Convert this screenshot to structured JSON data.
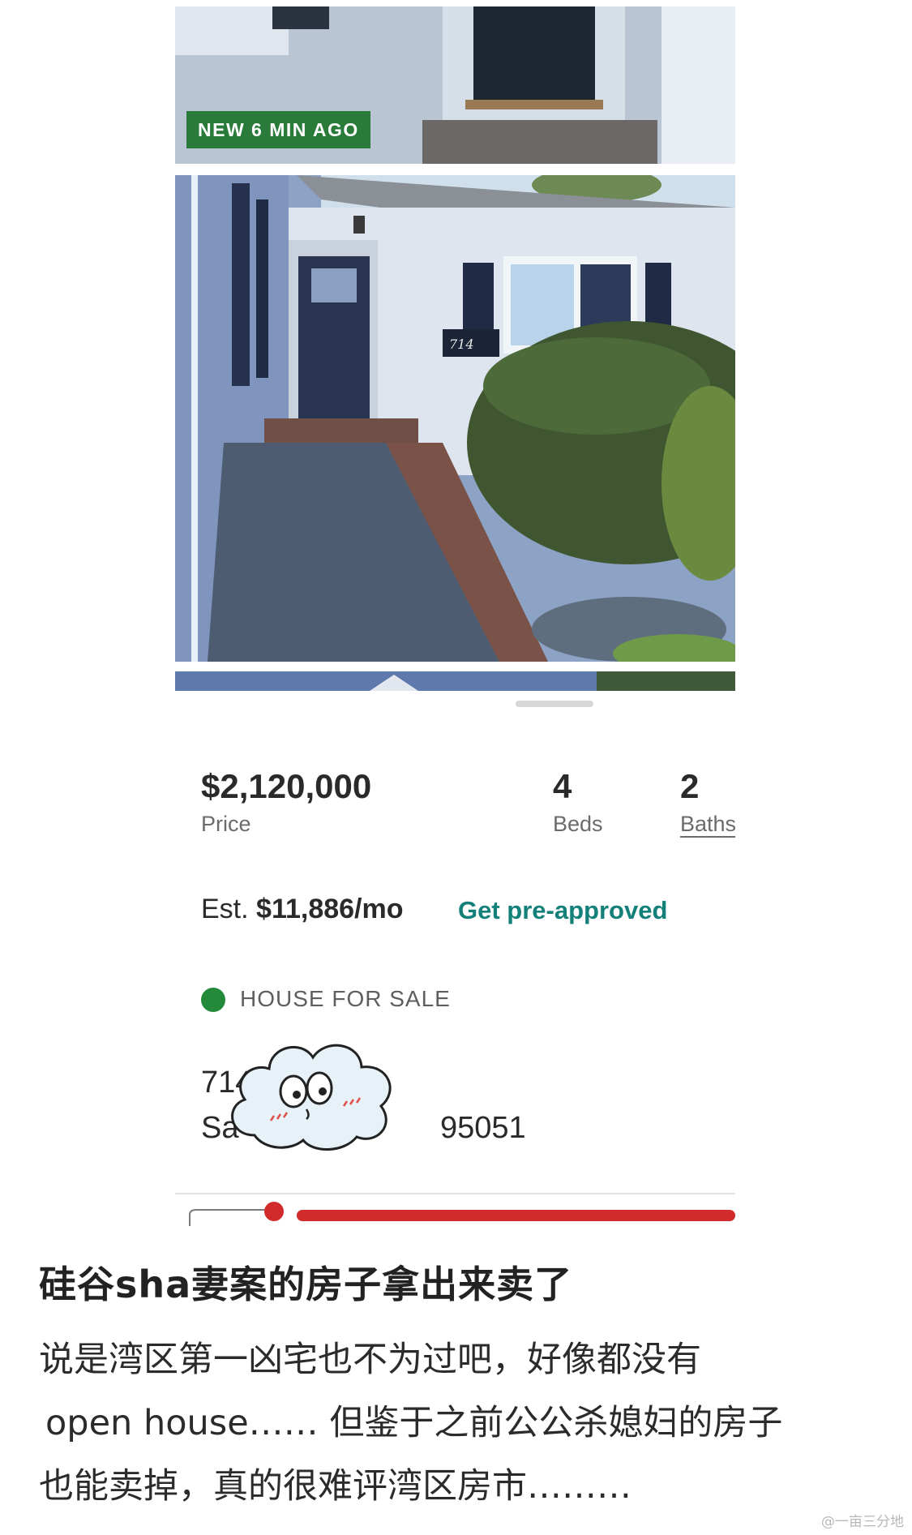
{
  "listing": {
    "badge": "NEW 6 MIN AGO",
    "price": "$2,120,000",
    "price_label": "Price",
    "beds": "4",
    "beds_label": "Beds",
    "baths": "2",
    "baths_label": "Baths",
    "est_prefix": "Est.",
    "est_payment": "$11,886/mo",
    "preapproved_link": "Get pre-approved",
    "status": "HOUSE FOR SALE",
    "status_color": "#238a3a",
    "address_line1": "714",
    "address_line2_start": "Sa",
    "address_line2_end": "95051",
    "house_number_sign": "714",
    "accent_color": "#14807a"
  },
  "sticker": {
    "icon": "cloud-face-sticker"
  },
  "post": {
    "title": "硅谷sha妻案的房子拿出来卖了",
    "body_lines": [
      "说是湾区第一凶宅也不为过吧，好像都没有",
      "open house…… 但鉴于之前公公杀媳妇的房子",
      "也能卖掉，真的很难评湾区房市………"
    ]
  },
  "watermark": "@一亩三分地"
}
